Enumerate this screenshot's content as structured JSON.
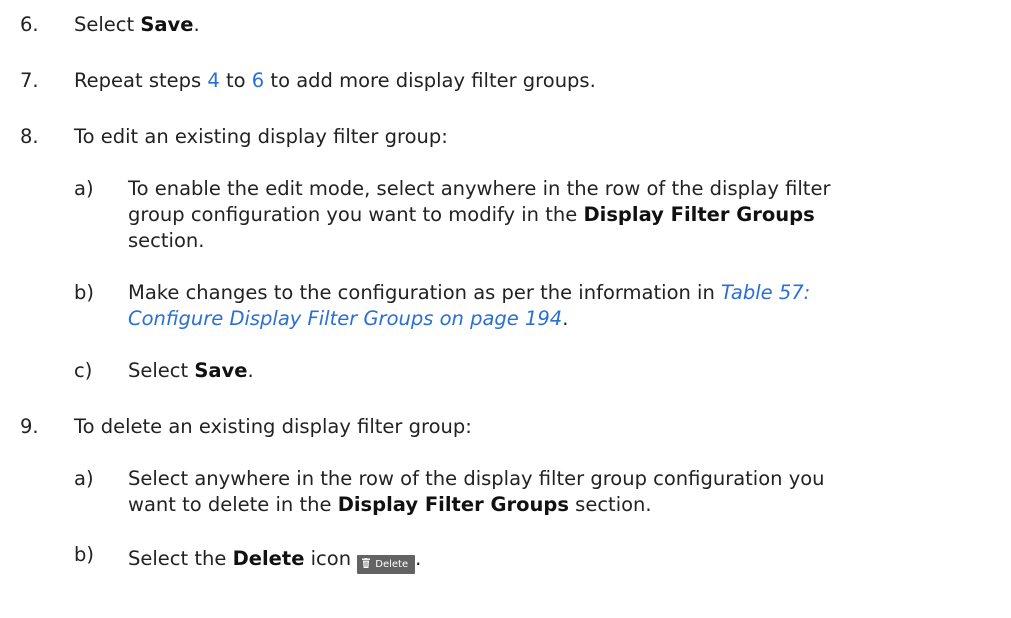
{
  "steps": {
    "s6": {
      "num": "6.",
      "pre": "Select ",
      "bold": "Save",
      "post": "."
    },
    "s7": {
      "num": "7.",
      "pre": "Repeat steps ",
      "link1": "4",
      "mid": " to ",
      "link2": "6",
      "post": " to add more display filter groups."
    },
    "s8": {
      "num": "8.",
      "text": "To edit an existing display filter group:",
      "a": {
        "letter": "a)",
        "line1": "To enable the edit mode, select anywhere in the row of the display filter",
        "line2_pre": "group configuration you want to modify in the ",
        "line2_bold": "Display Filter Groups",
        "line3": "section."
      },
      "b": {
        "letter": "b)",
        "line1_pre": "Make changes to the configuration as per the information in ",
        "line1_link": "Table 57:",
        "line2_link": "Configure Display Filter Groups on page 194",
        "line2_post": "."
      },
      "c": {
        "letter": "c)",
        "pre": "Select ",
        "bold": "Save",
        "post": "."
      }
    },
    "s9": {
      "num": "9.",
      "text": "To delete an existing display filter group:",
      "a": {
        "letter": "a)",
        "line1": "Select anywhere in the row of the display filter group configuration you",
        "line2_pre": "want to delete in the ",
        "line2_bold": "Display Filter Groups",
        "line2_post": " section."
      },
      "b": {
        "letter": "b)",
        "pre": "Select the ",
        "bold": "Delete",
        "mid": " icon ",
        "button_label": "Delete",
        "button_icon": "trash-icon",
        "post": "."
      }
    }
  },
  "colors": {
    "link": "#2a6fd6",
    "button_bg": "#636363"
  }
}
